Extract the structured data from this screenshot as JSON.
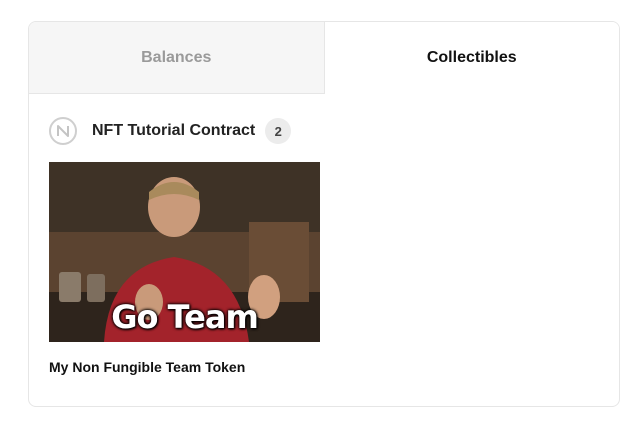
{
  "tabs": [
    {
      "label": "Balances",
      "active": false
    },
    {
      "label": "Collectibles",
      "active": true
    }
  ],
  "contract": {
    "name": "NFT Tutorial Contract",
    "count": "2",
    "icon": "near-logo-icon"
  },
  "nft": {
    "title": "My Non Fungible Team Token",
    "image_caption": "Go Team"
  },
  "colors": {
    "inactive_tab_bg": "#f6f6f6",
    "inactive_tab_text": "#9a9a9a",
    "active_tab_text": "#111111",
    "badge_bg": "#ececec"
  }
}
